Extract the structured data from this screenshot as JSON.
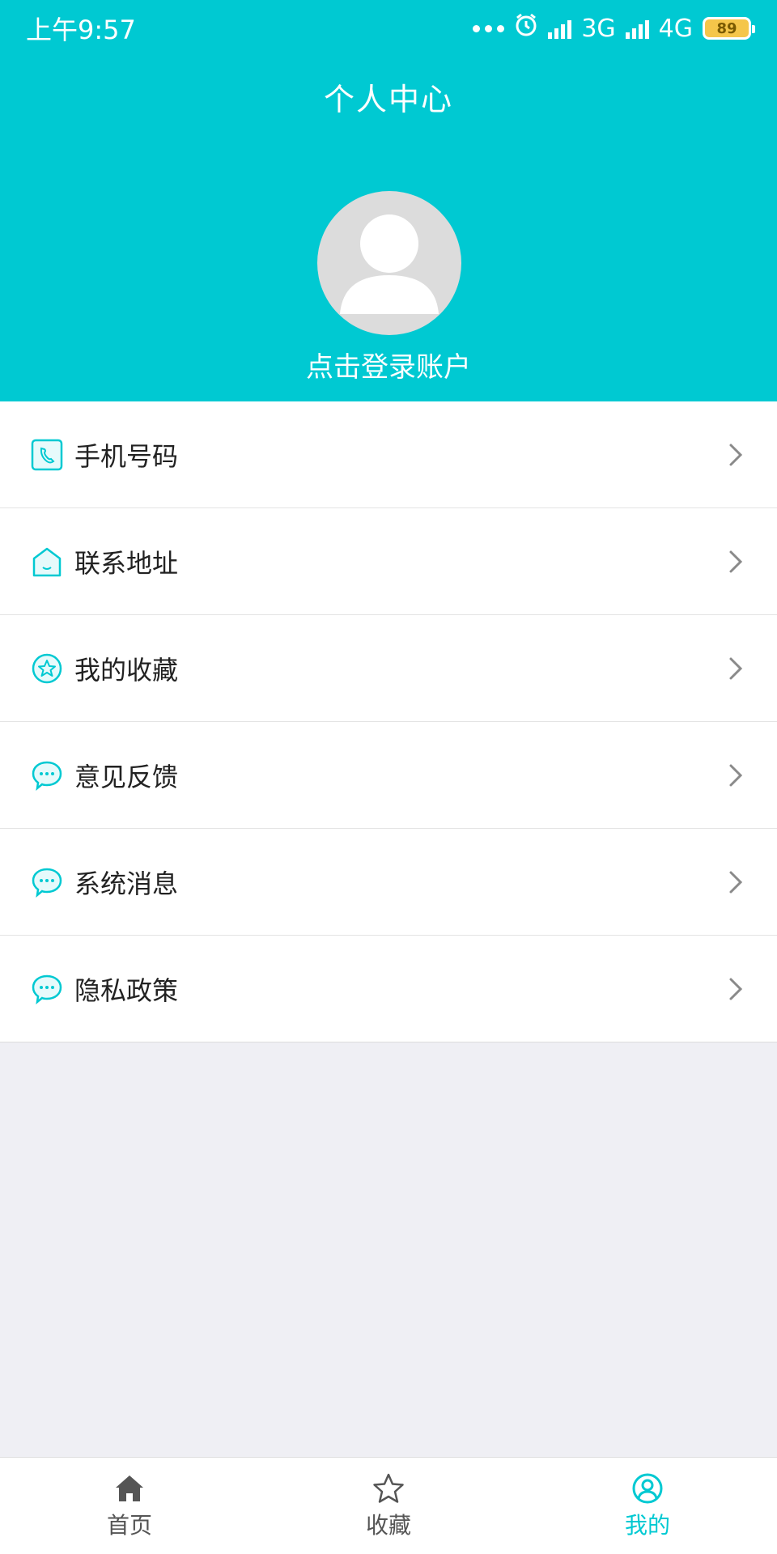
{
  "status_bar": {
    "time": "上午9:57",
    "network_1": "3G",
    "network_2": "4G",
    "battery": "89"
  },
  "header": {
    "title": "个人中心",
    "login_prompt": "点击登录账户"
  },
  "menu": {
    "items": [
      {
        "label": "手机号码",
        "icon": "phone-icon"
      },
      {
        "label": "联系地址",
        "icon": "house-icon"
      },
      {
        "label": "我的收藏",
        "icon": "star-badge-icon"
      },
      {
        "label": "意见反馈",
        "icon": "chat-bubble-icon"
      },
      {
        "label": "系统消息",
        "icon": "chat-bubble-icon"
      },
      {
        "label": "隐私政策",
        "icon": "chat-bubble-icon"
      }
    ]
  },
  "tabbar": {
    "items": [
      {
        "label": "首页",
        "icon": "home-icon"
      },
      {
        "label": "收藏",
        "icon": "star-outline-icon"
      },
      {
        "label": "我的",
        "icon": "user-icon",
        "active": true
      }
    ]
  },
  "colors": {
    "accent": "#00c9d2",
    "background": "#efeff4"
  }
}
